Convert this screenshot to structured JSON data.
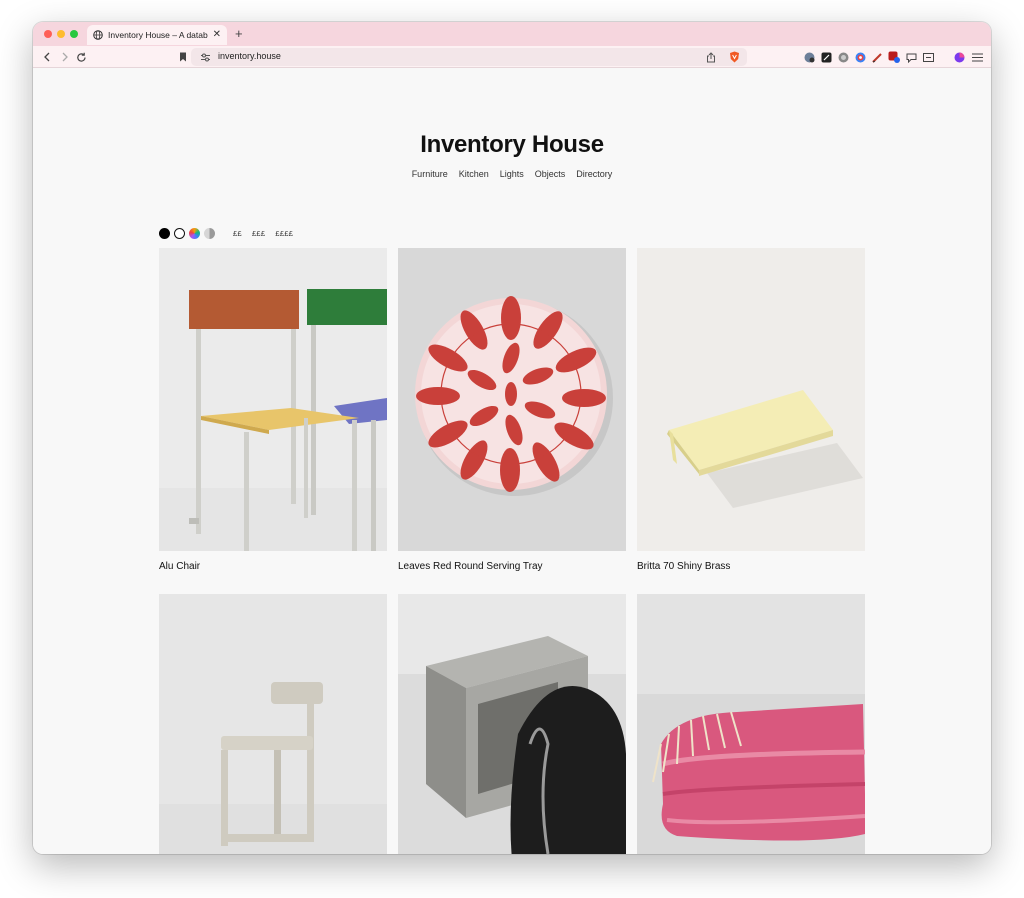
{
  "browser": {
    "tab_title": "Inventory House – A database",
    "url": "inventory.house"
  },
  "site": {
    "title": "Inventory House",
    "nav": [
      "Furniture",
      "Kitchen",
      "Lights",
      "Objects",
      "Directory"
    ],
    "filters": {
      "colors": [
        {
          "name": "black",
          "color": "#000000"
        },
        {
          "name": "white",
          "color": "#ffffff"
        },
        {
          "name": "multicolour",
          "color": "#8a7de0"
        },
        {
          "name": "metallic",
          "color": "#b5b5b5"
        }
      ],
      "prices": [
        "££",
        "£££",
        "££££"
      ]
    },
    "products": [
      {
        "name": "Alu Chair"
      },
      {
        "name": "Leaves Red Round Serving Tray"
      },
      {
        "name": "Britta 70 Shiny Brass"
      },
      {
        "name": ""
      },
      {
        "name": ""
      },
      {
        "name": ""
      }
    ]
  },
  "colors": {
    "tab_strip": "#f6d6de",
    "toolbar": "#fdf1f3",
    "page_bg": "#f8f8f8",
    "accent_red": "#c9403a"
  }
}
